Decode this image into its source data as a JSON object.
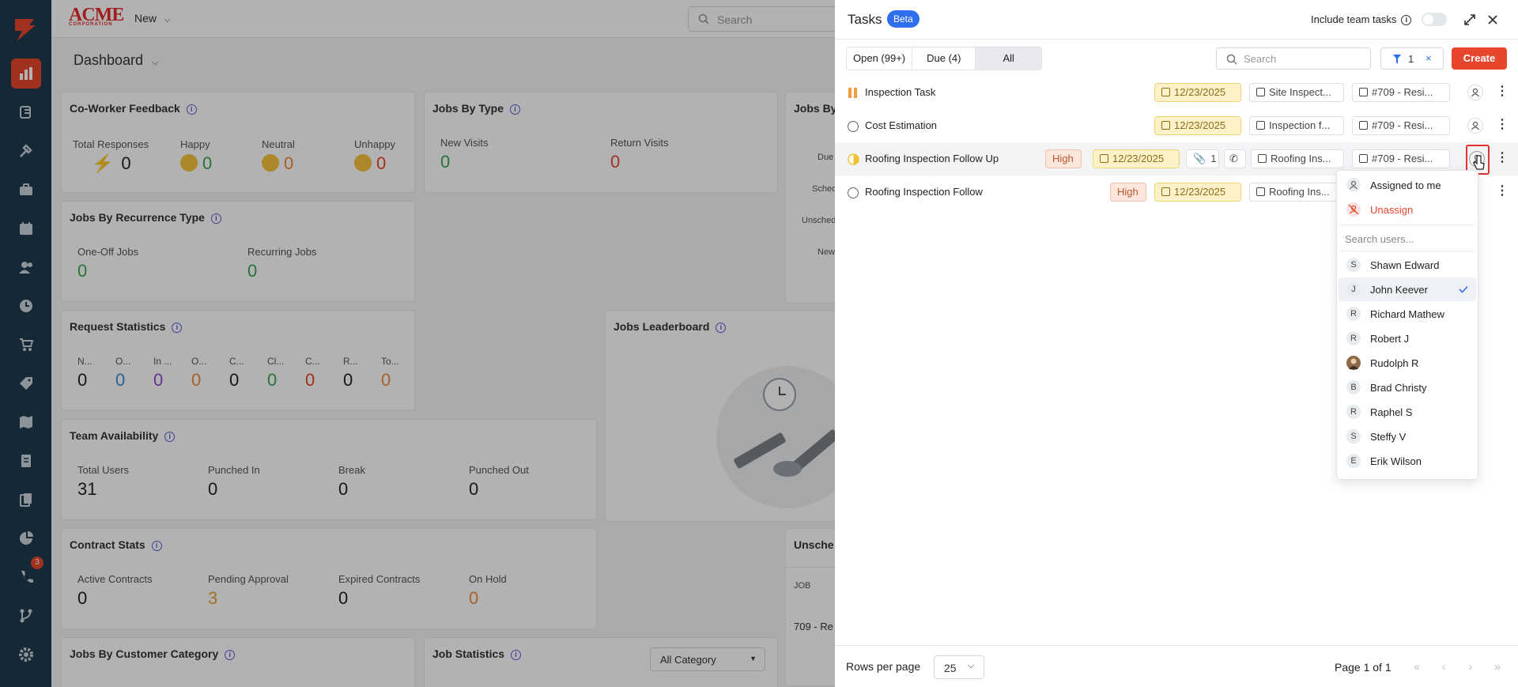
{
  "sidebar": {
    "badge": "3"
  },
  "app": {
    "brand_name": "ACME",
    "brand_sub": "CORPORATION",
    "new_label": "New",
    "search_placeholder": "Search"
  },
  "dashboard": {
    "title": "Dashboard",
    "coworker": {
      "title": "Co-Worker Feedback",
      "total_label": "Total Responses",
      "total": "0",
      "happy_label": "Happy",
      "happy": "0",
      "neutral_label": "Neutral",
      "neutral": "0",
      "unhappy_label": "Unhappy",
      "unhappy": "0"
    },
    "jobs_by_type": {
      "title": "Jobs By Type",
      "new_label": "New Visits",
      "new": "0",
      "return_label": "Return Visits",
      "return": "0"
    },
    "jobs_by_partial": {
      "title": "Jobs By",
      "l1": "Due",
      "l2": "Sched",
      "l3": "Unsched",
      "l4": "New"
    },
    "recurrence": {
      "title": "Jobs By Recurrence Type",
      "oneoff_label": "One-Off Jobs",
      "oneoff": "0",
      "recurring_label": "Recurring Jobs",
      "recurring": "0"
    },
    "request_stats": {
      "title": "Request Statistics",
      "items": [
        {
          "label": "N...",
          "value": "0"
        },
        {
          "label": "O...",
          "value": "0"
        },
        {
          "label": "In ...",
          "value": "0"
        },
        {
          "label": "O...",
          "value": "0"
        },
        {
          "label": "C...",
          "value": "0"
        },
        {
          "label": "Cl...",
          "value": "0"
        },
        {
          "label": "C...",
          "value": "0"
        },
        {
          "label": "R...",
          "value": "0"
        },
        {
          "label": "To...",
          "value": "0"
        }
      ]
    },
    "leaderboard": {
      "title": "Jobs Leaderboard"
    },
    "team": {
      "title": "Team Availability",
      "total_label": "Total Users",
      "total": "31",
      "in_label": "Punched In",
      "in": "0",
      "break_label": "Break",
      "break": "0",
      "out_label": "Punched Out",
      "out": "0"
    },
    "contract": {
      "title": "Contract Stats",
      "active_label": "Active Contracts",
      "active": "0",
      "pending_label": "Pending Approval",
      "pending": "3",
      "expired_label": "Expired Contracts",
      "expired": "0",
      "hold_label": "On Hold",
      "hold": "0"
    },
    "unsched": {
      "title": "Unsche",
      "col": "JOB",
      "row": "709 - Re"
    },
    "customer_cat": {
      "title": "Jobs By Customer Category"
    },
    "job_stats": {
      "title": "Job Statistics",
      "category_select": "All Category"
    }
  },
  "tasks": {
    "title": "Tasks",
    "beta": "Beta",
    "include_team": "Include team tasks",
    "tabs": [
      {
        "label": "Open (99+)"
      },
      {
        "label": "Due (4)"
      },
      {
        "label": "All"
      }
    ],
    "search_placeholder": "Search",
    "filter_count": "1",
    "create_label": "Create",
    "rows": [
      {
        "name": "Inspection Task",
        "date": "12/23/2025",
        "form": "Site Inspect...",
        "job": "#709 - Resi..."
      },
      {
        "name": "Cost Estimation",
        "date": "12/23/2025",
        "form": "Inspection f...",
        "job": "#709 - Resi..."
      },
      {
        "name": "Roofing Inspection Follow Up",
        "priority": "High",
        "date": "12/23/2025",
        "attachments": "1",
        "form": "Roofing Ins...",
        "job": "#709 - Resi..."
      },
      {
        "name": "Roofing Inspection Follow",
        "priority": "High",
        "date": "12/23/2025",
        "form": "Roofing Ins..."
      }
    ],
    "rows_per_page_label": "Rows per page",
    "rows_per_page": "25",
    "page_info": "Page 1 of 1"
  },
  "assign_menu": {
    "assigned_to_me": "Assigned to me",
    "unassign": "Unassign",
    "search_placeholder": "Search users...",
    "users": [
      {
        "initial": "S",
        "name": "Shawn Edward"
      },
      {
        "initial": "J",
        "name": "John Keever",
        "selected": true
      },
      {
        "initial": "R",
        "name": "Richard Mathew"
      },
      {
        "initial": "R",
        "name": "Robert J"
      },
      {
        "initial": "",
        "name": "Rudolph R"
      },
      {
        "initial": "B",
        "name": "Brad Christy"
      },
      {
        "initial": "R",
        "name": "Raphel S"
      },
      {
        "initial": "S",
        "name": "Steffy V"
      },
      {
        "initial": "E",
        "name": "Erik Wilson"
      }
    ]
  }
}
